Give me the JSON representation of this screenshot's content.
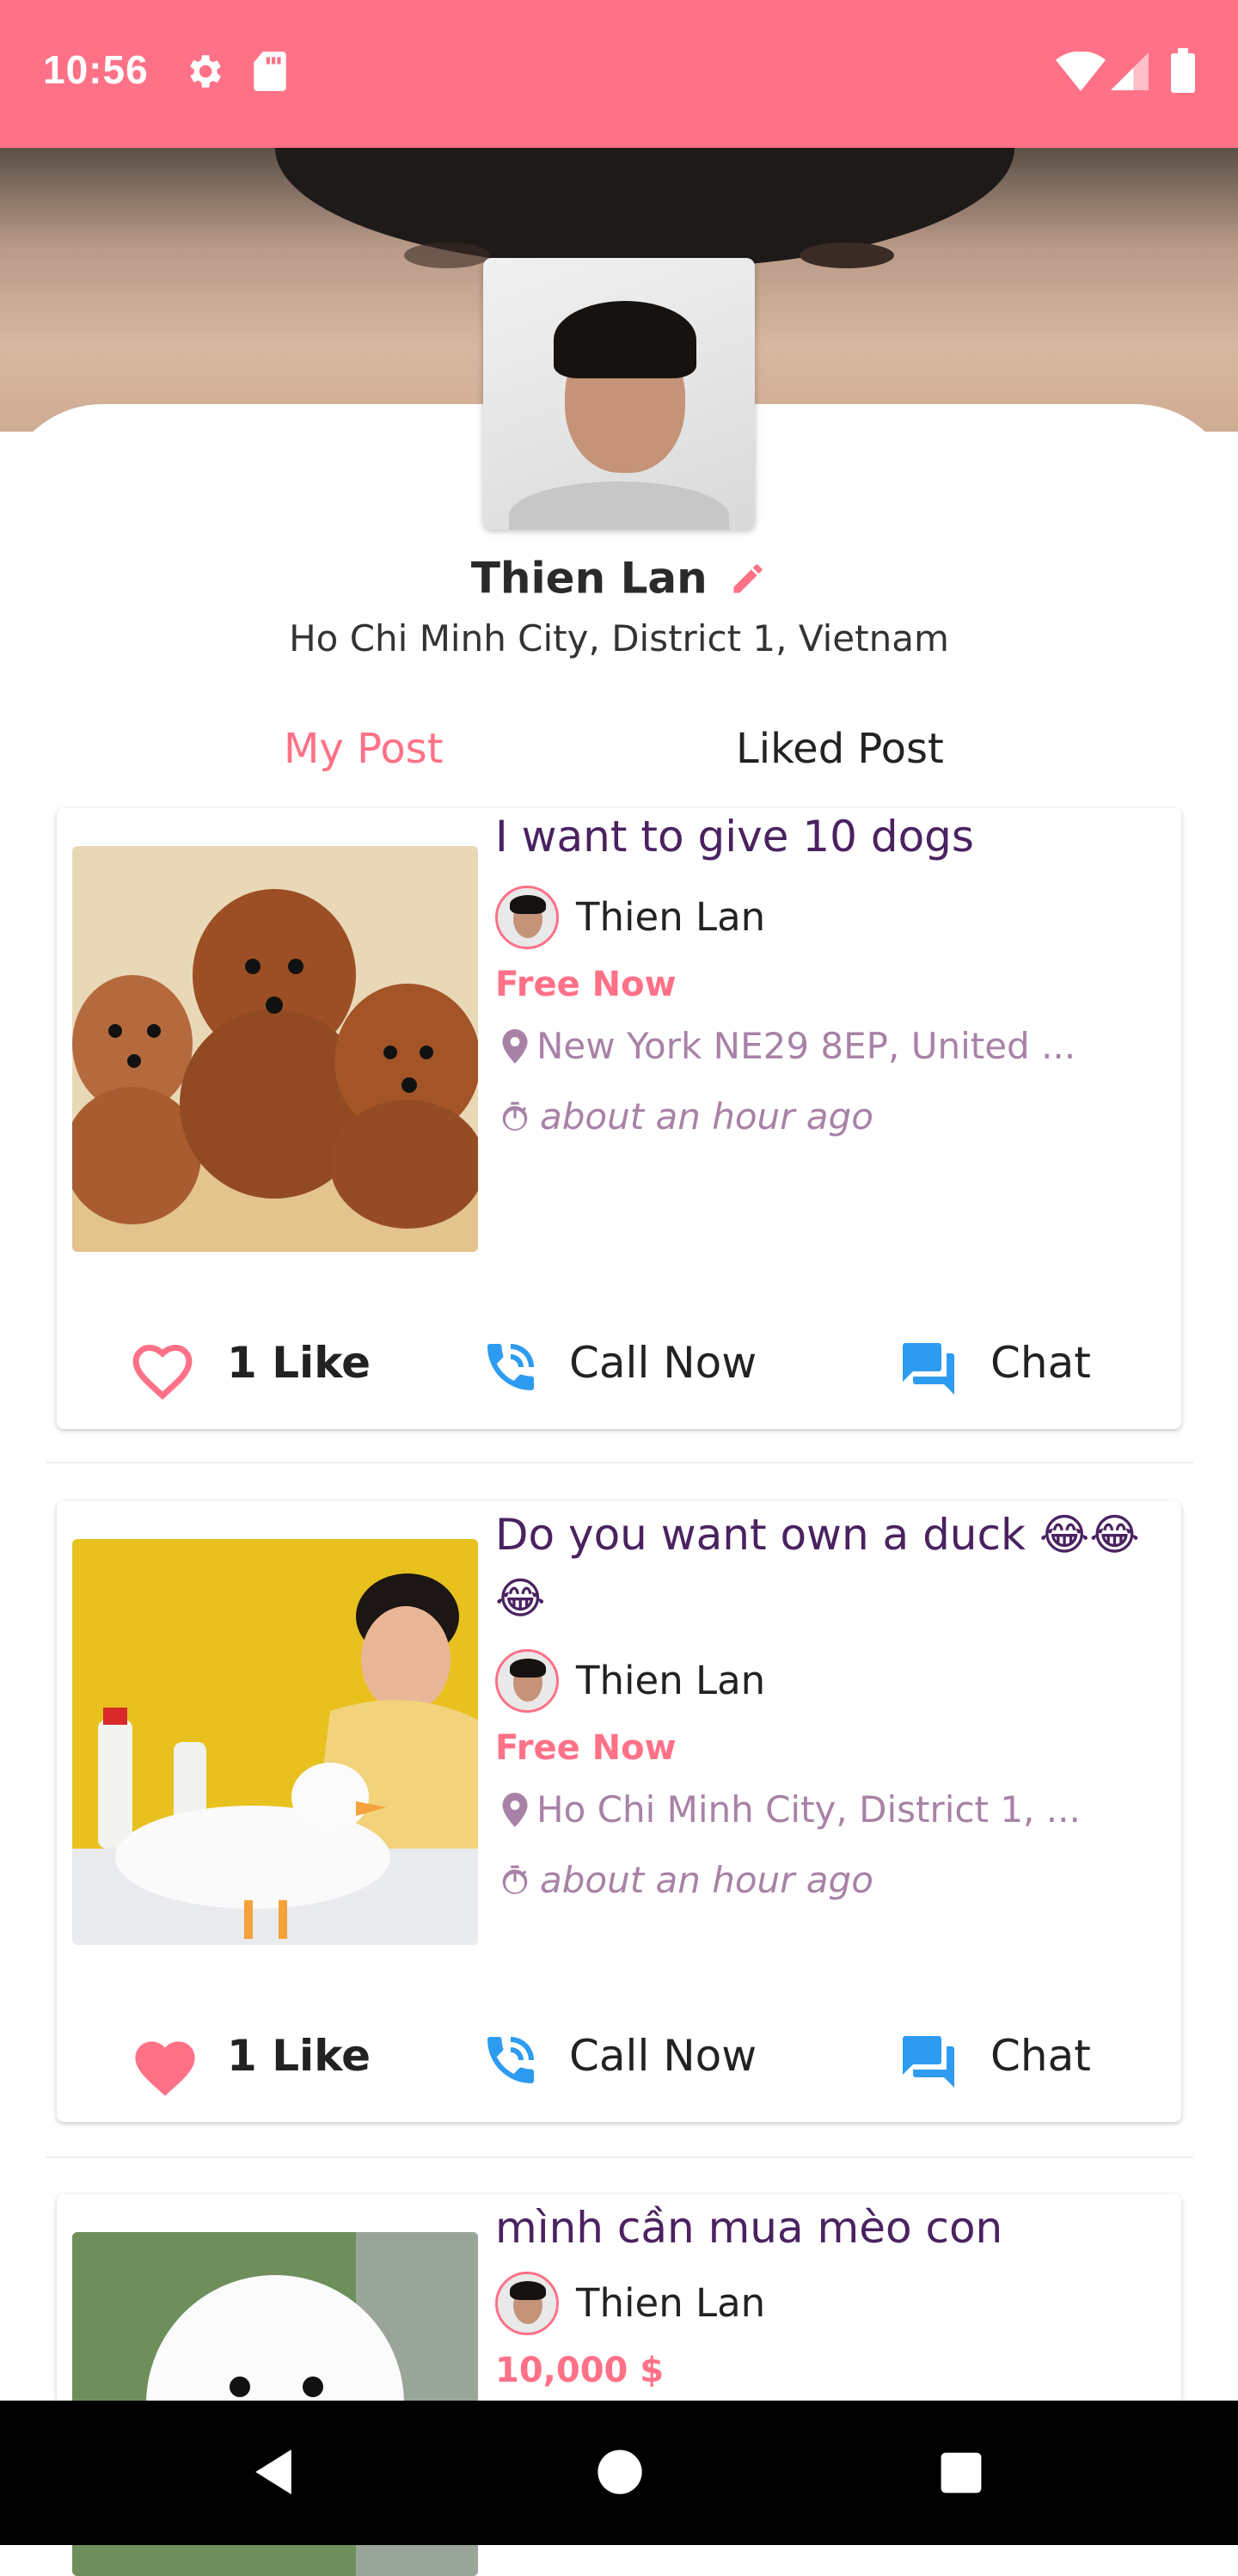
{
  "status_bar": {
    "time": "10:56",
    "icons": [
      "gear-icon",
      "sd-card-icon",
      "wifi-icon",
      "signal-icon",
      "battery-icon"
    ]
  },
  "profile": {
    "name": "Thien Lan",
    "location": "Ho Chi Minh City, District 1, Vietnam"
  },
  "tabs": [
    {
      "label": "My Post",
      "active": true
    },
    {
      "label": "Liked Post",
      "active": false
    }
  ],
  "posts": [
    {
      "title": "I want to give 10 dogs",
      "author": "Thien Lan",
      "price": "Free Now",
      "location": "New York NE29 8EP, United ...",
      "time": "about an hour ago",
      "likes": "1 Like",
      "liked": false,
      "call_label": "Call Now",
      "chat_label": "Chat"
    },
    {
      "title": "Do you want own a duck 😂😂😂",
      "author": "Thien Lan",
      "price": "Free Now",
      "location": "Ho Chi Minh City, District 1, ...",
      "time": "about an hour ago",
      "likes": "1 Like",
      "liked": true,
      "call_label": "Call Now",
      "chat_label": "Chat"
    },
    {
      "title": "mình cần mua mèo con",
      "author": "Thien Lan",
      "price": "10,000 $"
    }
  ],
  "colors": {
    "accent": "#FF7187",
    "title_purple": "#4a2260",
    "muted_purple": "#a882a6",
    "action_blue": "#2d9cf0"
  },
  "nav_bar": [
    "back-icon",
    "home-icon",
    "recents-icon"
  ]
}
